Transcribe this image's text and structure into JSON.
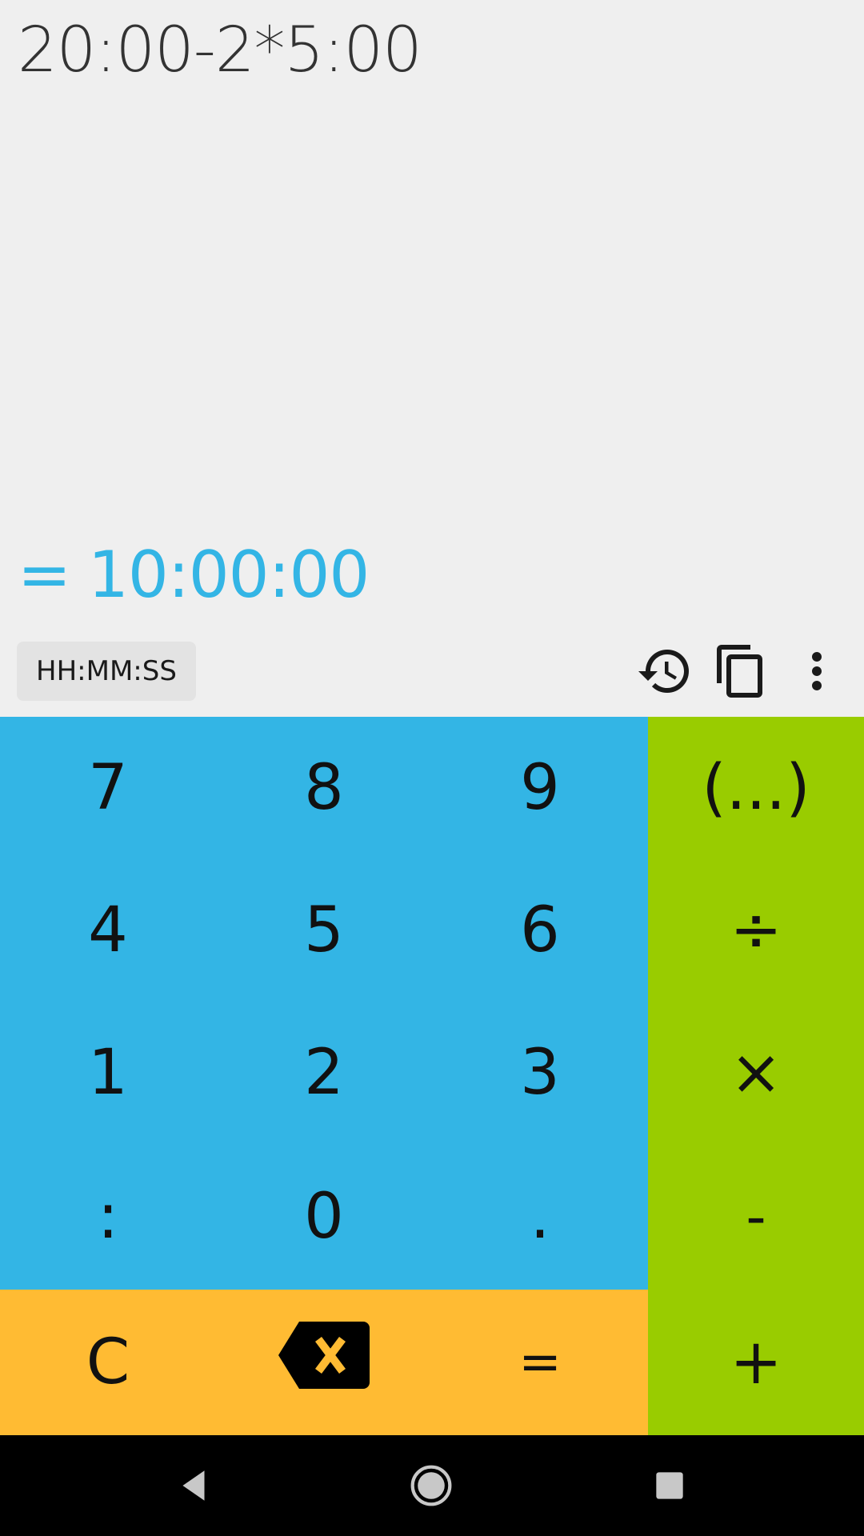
{
  "display": {
    "expression": "20:00-2*5:00",
    "result_prefix": "=",
    "result": "10:00:00"
  },
  "toolbar": {
    "format_label": "HH:MM:SS",
    "icons": [
      "history-icon",
      "copy-icon",
      "more-vert-icon"
    ]
  },
  "keypad": {
    "rows": [
      [
        "7",
        "8",
        "9",
        "(...)"
      ],
      [
        "4",
        "5",
        "6",
        "÷"
      ],
      [
        "1",
        "2",
        "3",
        "×"
      ],
      [
        ":",
        "0",
        ".",
        "-"
      ],
      [
        "C",
        "⌫",
        "=",
        "+"
      ]
    ],
    "backspace_icon": "backspace-icon"
  },
  "colors": {
    "number_keys": "#33b5e5",
    "operator_keys": "#99cc00",
    "utility_keys": "#ffbb33",
    "result_text": "#33b5e5",
    "display_bg": "#efefef"
  },
  "navbar": {
    "icons": [
      "back-icon",
      "home-icon",
      "recents-icon"
    ]
  }
}
